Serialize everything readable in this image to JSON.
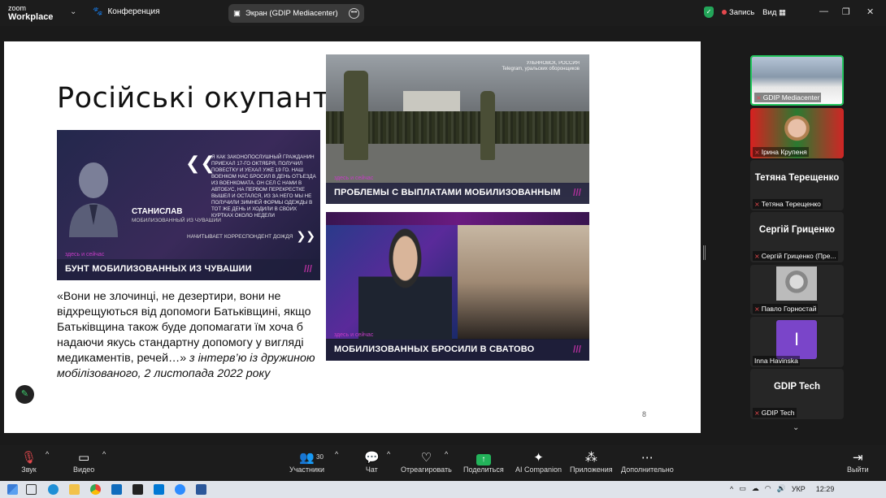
{
  "titlebar": {
    "brand_line1": "zoom",
    "brand_line2": "Workplace",
    "meeting_label": "Конференция",
    "share_pill": "Экран (GDIP Mediacenter)",
    "record_label": "Запись",
    "view_label": "Вид"
  },
  "slide": {
    "title": "Російські окупанти",
    "page_number": "8",
    "news1": {
      "quote": "Я как законопослушный гражданин приехал 17-го октября, получил повестку и уехал уже 19 го. Наш военком нас бросил в день отъезда из военкомата. Он сел с нами в автобус, на первом перекрестке вышел и остался, из за него мы не получили зимней формы одежды в тот же день и ходили в своих куртках около недели",
      "name": "Станислав",
      "role": "мобилизованный из Чувашии",
      "correspondent": "начитывает корреспондент дождя",
      "tag": "здесь и сейчас",
      "headline": "БУНТ МОБИЛИЗОВАННЫХ ИЗ ЧУВАШИИ",
      "slashes": "///"
    },
    "news2": {
      "location": "УЛЬЯНОВСК, РОССИЯ",
      "location_sub": "Telegram, уральских оборонщиков",
      "tag": "здесь и сейчас",
      "headline": "ПРОБЛЕМЫ С ВЫПЛАТАМИ МОБИЛИЗОВАННЫМ",
      "slashes": "///"
    },
    "news3": {
      "tag": "здесь и сейчас",
      "headline": "МОБИЛИЗОВАННЫХ БРОСИЛИ В СВАТОВО",
      "slashes": "///"
    },
    "quote_main": "«Вони не злочинці, не дезертири, вони не відхрещуються від допомоги Батьківщині, якщо Батьківщина також буде допомагати їм хоча б надаючи якусь стандартну допомогу у вигляді медикаментів, речей…»",
    "quote_source": " з інтерв’ю із дружиною мобілізованого, 2 листопада 2022 року"
  },
  "gallery": {
    "tiles": [
      {
        "name": "GDIP Mediacenter",
        "big": ""
      },
      {
        "name": "Ірина Крупеня",
        "big": ""
      },
      {
        "name": "Тетяна Терещенко",
        "big": "Тетяна Терещенко"
      },
      {
        "name": "Сергій Гриценко (Пре...",
        "big": "Сергій Гриценко"
      },
      {
        "name": "Павло Горностай",
        "big": ""
      },
      {
        "name": "Inna Havinska",
        "big": "",
        "avatar": "I"
      },
      {
        "name": "GDIP Tech",
        "big": "GDIP Tech"
      }
    ]
  },
  "toolbar": {
    "audio": "Звук",
    "video": "Видео",
    "participants": "Участники",
    "participants_count": "30",
    "chat": "Чат",
    "react": "Отреагировать",
    "share": "Поделиться",
    "ai": "AI Companion",
    "apps": "Приложения",
    "more": "Дополнительно",
    "leave": "Выйти"
  },
  "taskbar": {
    "lang": "УКР",
    "time": "12:29"
  },
  "colors": {
    "accent_green": "#23c55e",
    "record_red": "#e5484d",
    "headline_magenta": "#b0309a"
  }
}
